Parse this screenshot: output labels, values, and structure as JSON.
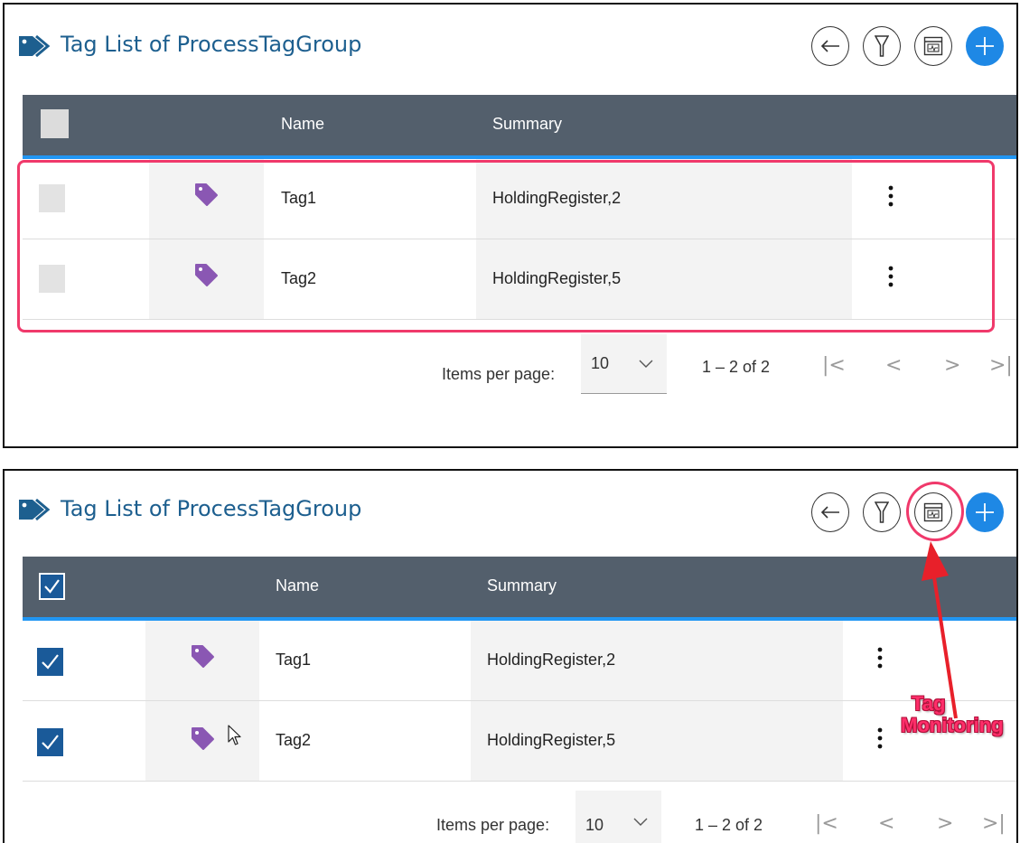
{
  "panels": [
    {
      "title": "Tag List of ProcessTagGroup",
      "header_checked": false,
      "columns": {
        "name": "Name",
        "summary": "Summary"
      },
      "rows": [
        {
          "name": "Tag1",
          "summary": "HoldingRegister,2",
          "checked": false
        },
        {
          "name": "Tag2",
          "summary": "HoldingRegister,5",
          "checked": false
        }
      ],
      "pager": {
        "items_label": "Items per page:",
        "page_size": "10",
        "range": "1 – 2 of 2"
      }
    },
    {
      "title": "Tag List of ProcessTagGroup",
      "header_checked": true,
      "columns": {
        "name": "Name",
        "summary": "Summary"
      },
      "rows": [
        {
          "name": "Tag1",
          "summary": "HoldingRegister,2",
          "checked": true
        },
        {
          "name": "Tag2",
          "summary": "HoldingRegister,5",
          "checked": true
        }
      ],
      "pager": {
        "items_label": "Items per page:",
        "page_size": "10",
        "range": "1 – 2 of 2"
      }
    }
  ],
  "toolbar_icons": [
    "back-arrow-icon",
    "filter-icon",
    "tag-monitoring-icon",
    "add-icon"
  ],
  "annotation": {
    "line1": "Tag",
    "line2": "Monitoring"
  },
  "colors": {
    "title": "#1d5f8f",
    "header_bg": "#535f6c",
    "header_accent": "#2196f3",
    "tag_icon": "#8a57b3",
    "checkbox_checked": "#1a5a99",
    "add_button": "#1e88e5",
    "highlight": "#f0396b"
  }
}
